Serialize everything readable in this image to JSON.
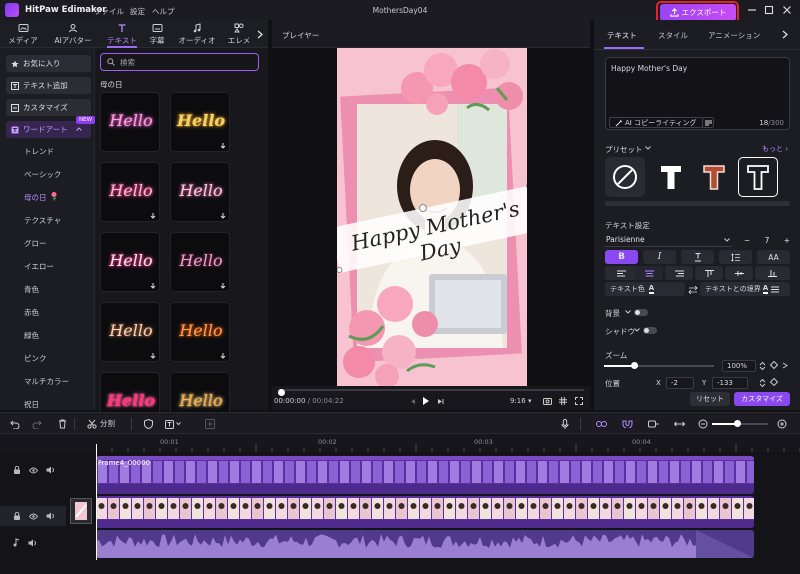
{
  "app": {
    "name": "HitPaw Edimakor",
    "menus": [
      "ファイル",
      "設定",
      "ヘルプ"
    ],
    "document_title": "MothersDay04",
    "export_label": "エクスポート"
  },
  "left_tabs": [
    {
      "label": "メディア",
      "icon": "media-icon",
      "active": false
    },
    {
      "label": "AIアバター",
      "icon": "ai-avatar-icon",
      "active": false
    },
    {
      "label": "テキスト",
      "icon": "text-icon",
      "active": true
    },
    {
      "label": "字幕",
      "icon": "subtitle-icon",
      "active": false
    },
    {
      "label": "オーディオ",
      "icon": "audio-icon",
      "active": false
    },
    {
      "label": "エレメ",
      "icon": "element-icon",
      "active": false
    }
  ],
  "left_nav": {
    "items": [
      {
        "label": "お気に入り",
        "icon": "star-icon"
      },
      {
        "label": "テキスト追加",
        "icon": "text-add-icon"
      },
      {
        "label": "カスタマイズ",
        "icon": "customize-icon"
      },
      {
        "label": "ワードアート",
        "icon": "word-art-icon",
        "badge": "NEW"
      }
    ],
    "sub_items": [
      "トレンド",
      "ベーシック",
      "母の日",
      "テクスチャ",
      "グロー",
      "イエロー",
      "青色",
      "赤色",
      "緑色",
      "ピンク",
      "マルチカラー",
      "祝日"
    ],
    "active_sub": "母の日"
  },
  "gallery": {
    "search_placeholder": "検索",
    "category": "母の日",
    "tiles": [
      {
        "text": "Hello",
        "color": "#f2a6d8",
        "glow": "#ff5fd2"
      },
      {
        "text": "Hello",
        "color": "#f5d170",
        "glow": "#d79a1e"
      },
      {
        "text": "Hello",
        "color": "#ffb4d0",
        "glow": "#ff4f9a"
      },
      {
        "text": "Hello",
        "color": "#f8c8e0",
        "glow": "#c06090"
      },
      {
        "text": "Hello",
        "color": "#ffe3ec",
        "glow": "#ff3d8a"
      },
      {
        "text": "Hello",
        "color": "#e8a0c8",
        "glow": "#7a2a50"
      },
      {
        "text": "Hello",
        "color": "#f6d2b8",
        "glow": "#a86a40"
      },
      {
        "text": "Hello",
        "color": "#ff9a4a",
        "glow": "#d85a10"
      },
      {
        "text": "Hello",
        "color": "#ff3a70",
        "glow": "#ff5fa8"
      },
      {
        "text": "Hello",
        "color": "#f6b250",
        "glow": "#ffd080"
      }
    ]
  },
  "player": {
    "label": "プレイヤー",
    "overlay_text": "Happy Mother's Day",
    "current_time": "00:00:00",
    "duration": "/ 00:04:22",
    "aspect_ratio": "9:16",
    "progress": 0.0
  },
  "right_panel": {
    "tabs": [
      {
        "label": "テキスト",
        "active": true
      },
      {
        "label": "スタイル",
        "active": false
      },
      {
        "label": "アニメーション",
        "active": false
      }
    ],
    "text_value": "Happy Mother's Day",
    "ai_copywriting": "AI コピーライティング",
    "char_count": "18",
    "char_max": "/300",
    "preset_label": "プリセット",
    "more_label": "もっと",
    "text_settings_label": "テキスト設定",
    "font": "Parisienne",
    "font_size": "7",
    "text_color_label": "テキスト色",
    "border_label": "テキストとの境界",
    "background_label": "背景",
    "shadow_label": "シャドウ",
    "zoom_label": "ズーム",
    "zoom_value": "100%",
    "zoom_level": 0.27,
    "position_label": "位置",
    "pos_x_label": "X",
    "pos_x": "-2",
    "pos_y_label": "Y",
    "pos_y": "-133",
    "reset_label": "リセット",
    "customize_label": "カスタマイズ"
  },
  "timeline": {
    "split_label": "分割",
    "ticks": [
      "00:01",
      "00:02",
      "00:03",
      "00:04"
    ],
    "text_clip_label": "Frame4_00000"
  },
  "colors": {
    "accent": "#9a43f5",
    "export_highlight": "#e8202a",
    "clip_purple": "#5a2fa0"
  }
}
